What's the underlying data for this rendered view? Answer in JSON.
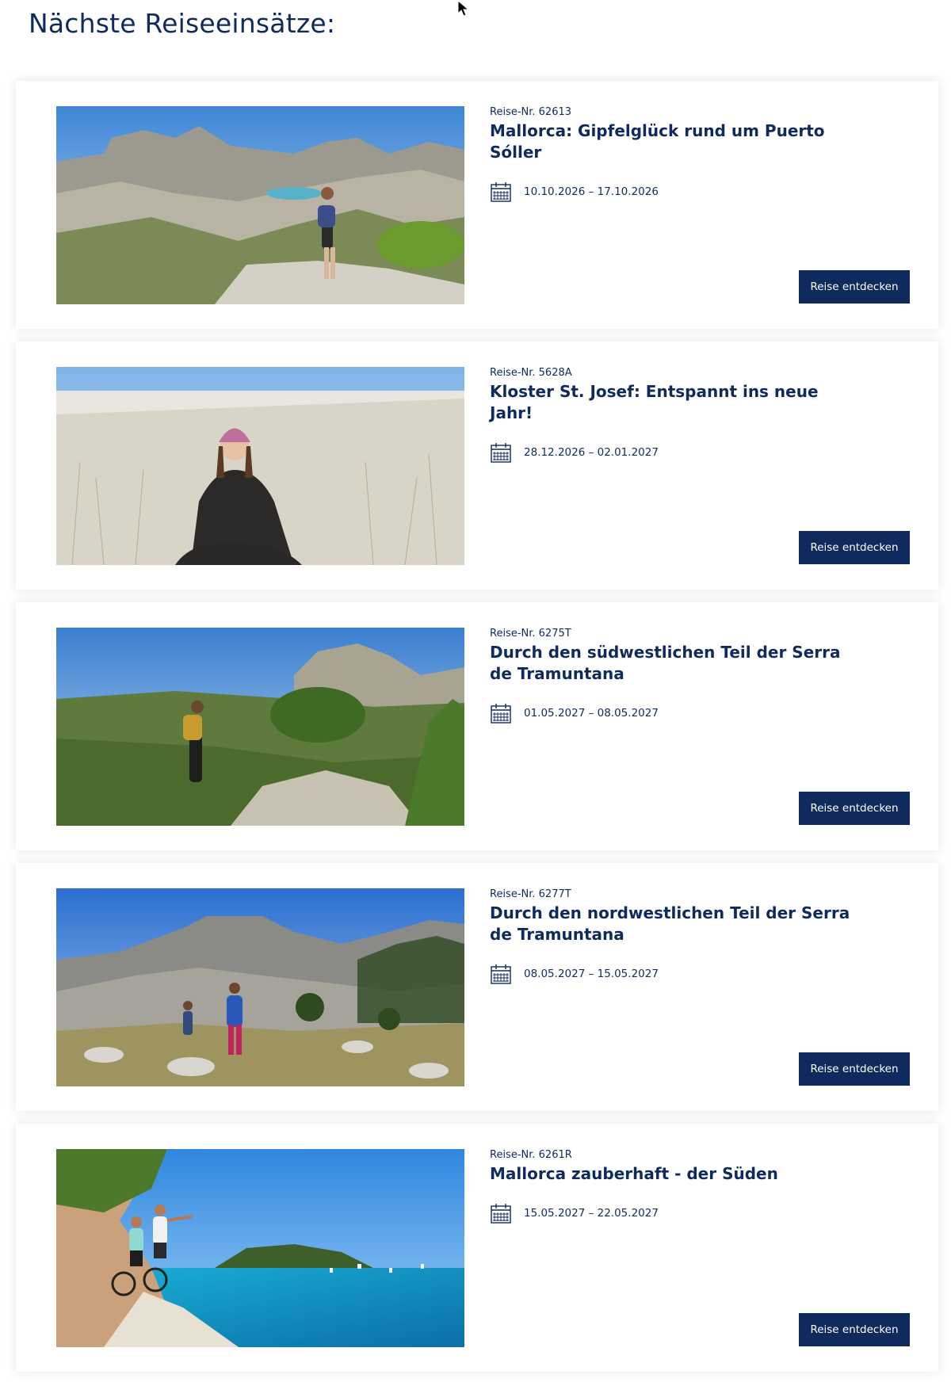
{
  "page": {
    "title": "Nächste Reiseeinsätze:"
  },
  "colors": {
    "primary": "#0f2a5c",
    "button_text": "#ffffff",
    "card_background": "#ffffff"
  },
  "trips": [
    {
      "number": "Reise-Nr. 62613",
      "title": "Mallorca: Gipfelglück rund um Puerto Sóller",
      "dates": "10.10.2026 – 17.10.2026",
      "button_label": "Reise entdecken",
      "image_subject": "hiker-on-mountain-ridge"
    },
    {
      "number": "Reise-Nr. 5628A",
      "title": "Kloster St. Josef: Entspannt ins neue Jahr!",
      "dates": "28.12.2026 – 02.01.2027",
      "button_label": "Reise entdecken",
      "image_subject": "woman-meditating-in-frosty-meadow"
    },
    {
      "number": "Reise-Nr. 6275T",
      "title": "Durch den südwestlichen Teil der Serra de Tramuntana",
      "dates": "01.05.2027 – 08.05.2027",
      "button_label": "Reise entdecken",
      "image_subject": "hiker-on-green-mountain-trail"
    },
    {
      "number": "Reise-Nr. 6277T",
      "title": "Durch den nordwestlichen Teil der Serra de Tramuntana",
      "dates": "08.05.2027 – 15.05.2027",
      "button_label": "Reise entdecken",
      "image_subject": "hiking-group-in-rocky-mountains"
    },
    {
      "number": "Reise-Nr. 6261R",
      "title": "Mallorca zauberhaft - der Süden",
      "dates": "15.05.2027 – 22.05.2027",
      "button_label": "Reise entdecken",
      "image_subject": "cyclists-at-turquoise-bay"
    }
  ]
}
